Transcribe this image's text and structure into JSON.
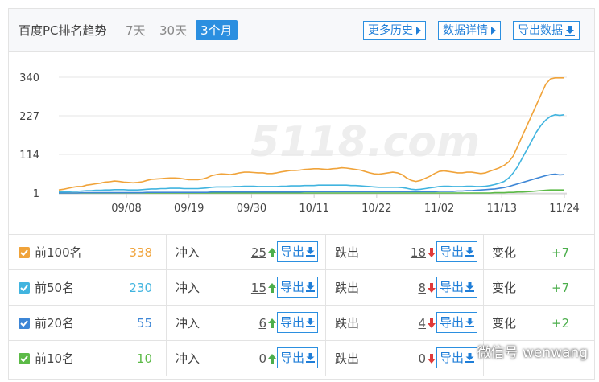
{
  "header": {
    "title": "百度PC排名趋势",
    "ranges": [
      "7天",
      "30天",
      "3个月"
    ],
    "active_range": "3个月",
    "buttons": {
      "more_history": "更多历史",
      "data_detail": "数据详情",
      "export_data": "导出数据"
    }
  },
  "chart_data": {
    "type": "line",
    "x_ticks": [
      "09/08",
      "09/19",
      "09/30",
      "10/11",
      "10/22",
      "11/02",
      "11/13",
      "11/24"
    ],
    "y_ticks": [
      "340",
      "227",
      "114",
      "1"
    ],
    "ylim": [
      1,
      340
    ],
    "watermark": "5118.com",
    "series": [
      {
        "color": "#f0a33a",
        "values": [
          10,
          12,
          15,
          18,
          20,
          20,
          24,
          26,
          28,
          30,
          33,
          34,
          36,
          35,
          33,
          32,
          31,
          32,
          34,
          38,
          41,
          42,
          43,
          44,
          45,
          45,
          44,
          42,
          40,
          40,
          40,
          42,
          46,
          52,
          55,
          57,
          56,
          55,
          57,
          60,
          62,
          62,
          61,
          60,
          60,
          58,
          58,
          60,
          63,
          65,
          67,
          67,
          68,
          70,
          71,
          72,
          72,
          71,
          70,
          72,
          73,
          75,
          74,
          72,
          70,
          68,
          64,
          60,
          57,
          56,
          58,
          60,
          62,
          60,
          55,
          45,
          38,
          35,
          38,
          44,
          50,
          58,
          64,
          66,
          64,
          62,
          60,
          60,
          62,
          62,
          60,
          58,
          60,
          65,
          70,
          75,
          82,
          92,
          110,
          140,
          170,
          200,
          230,
          260,
          290,
          320,
          335,
          338,
          338,
          338
        ]
      },
      {
        "color": "#41b4df",
        "values": [
          4,
          4,
          5,
          6,
          6,
          7,
          8,
          8,
          9,
          9,
          10,
          10,
          11,
          11,
          11,
          10,
          10,
          10,
          11,
          12,
          13,
          13,
          14,
          14,
          15,
          15,
          15,
          14,
          14,
          14,
          14,
          15,
          16,
          18,
          19,
          19,
          19,
          19,
          20,
          20,
          21,
          21,
          21,
          20,
          20,
          20,
          20,
          20,
          21,
          21,
          22,
          22,
          22,
          23,
          23,
          23,
          24,
          24,
          24,
          24,
          24,
          24,
          24,
          23,
          23,
          22,
          21,
          20,
          19,
          18,
          18,
          18,
          18,
          18,
          17,
          15,
          12,
          11,
          12,
          14,
          16,
          18,
          20,
          21,
          21,
          20,
          20,
          20,
          21,
          21,
          20,
          20,
          21,
          23,
          26,
          30,
          35,
          45,
          60,
          80,
          105,
          130,
          155,
          180,
          200,
          215,
          225,
          230,
          228,
          230
        ]
      },
      {
        "color": "#3d86d6",
        "values": [
          1,
          1,
          1,
          1,
          1,
          2,
          2,
          2,
          2,
          2,
          2,
          2,
          2,
          2,
          2,
          2,
          2,
          2,
          2,
          3,
          3,
          3,
          3,
          3,
          3,
          3,
          3,
          3,
          3,
          3,
          3,
          3,
          3,
          4,
          4,
          4,
          4,
          4,
          4,
          4,
          4,
          4,
          4,
          4,
          4,
          4,
          4,
          4,
          4,
          4,
          4,
          4,
          4,
          5,
          5,
          5,
          5,
          5,
          5,
          5,
          5,
          5,
          5,
          5,
          5,
          5,
          5,
          5,
          5,
          5,
          5,
          5,
          5,
          5,
          5,
          5,
          5,
          5,
          5,
          5,
          5,
          5,
          6,
          6,
          6,
          6,
          7,
          7,
          8,
          8,
          9,
          10,
          11,
          12,
          13,
          15,
          17,
          20,
          24,
          28,
          32,
          36,
          40,
          44,
          48,
          52,
          55,
          56,
          54,
          55
        ]
      },
      {
        "color": "#5cba47",
        "values": [
          1,
          1,
          1,
          1,
          1,
          1,
          1,
          1,
          1,
          1,
          1,
          1,
          1,
          1,
          1,
          1,
          1,
          1,
          1,
          1,
          1,
          1,
          1,
          1,
          1,
          1,
          1,
          1,
          1,
          1,
          1,
          1,
          1,
          1,
          1,
          1,
          1,
          1,
          1,
          1,
          1,
          1,
          1,
          1,
          1,
          1,
          1,
          1,
          1,
          1,
          1,
          1,
          1,
          1,
          1,
          1,
          1,
          1,
          1,
          1,
          1,
          1,
          1,
          1,
          1,
          1,
          1,
          1,
          1,
          1,
          1,
          1,
          1,
          1,
          1,
          1,
          1,
          1,
          1,
          1,
          1,
          1,
          1,
          1,
          1,
          1,
          1,
          1,
          1,
          1,
          1,
          1,
          1,
          1,
          2,
          2,
          2,
          3,
          3,
          4,
          4,
          5,
          6,
          7,
          8,
          9,
          10,
          10,
          10,
          10
        ]
      }
    ]
  },
  "rows": [
    {
      "color": "#f0a33a",
      "label": "前100名",
      "count": "338",
      "count_color": "#f0a33a",
      "in_label": "冲入",
      "in_value": "25",
      "out_label": "跌出",
      "out_value": "18",
      "export": "导出",
      "change_label": "变化",
      "change": "+7"
    },
    {
      "color": "#41b4df",
      "label": "前50名",
      "count": "230",
      "count_color": "#41b4df",
      "in_label": "冲入",
      "in_value": "15",
      "out_label": "跌出",
      "out_value": "8",
      "export": "导出",
      "change_label": "变化",
      "change": "+7"
    },
    {
      "color": "#3d86d6",
      "label": "前20名",
      "count": "55",
      "count_color": "#3d86d6",
      "in_label": "冲入",
      "in_value": "6",
      "out_label": "跌出",
      "out_value": "4",
      "export": "导出",
      "change_label": "变化",
      "change": "+2"
    },
    {
      "color": "#5cba47",
      "label": "前10名",
      "count": "10",
      "count_color": "#5cba47",
      "in_label": "冲入",
      "in_value": "0",
      "out_label": "跌出",
      "out_value": "0",
      "export": "导出",
      "change_label": "",
      "change": ""
    }
  ],
  "overlay_watermark": "微信号 wenwang",
  "icons": {
    "arrow_right": "caret-right-icon",
    "download": "download-icon",
    "check": "check-icon",
    "up": "arrow-up-icon",
    "down": "arrow-down-icon"
  }
}
